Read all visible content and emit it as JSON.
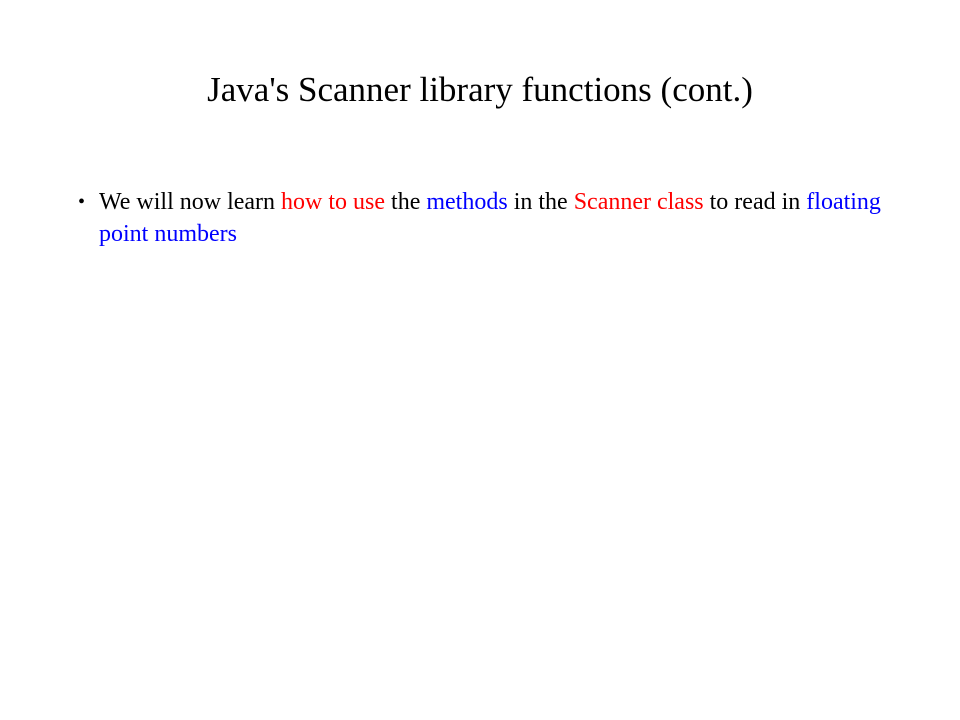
{
  "title": "Java's Scanner library functions (cont.)",
  "bullet": {
    "t1": "We will now learn ",
    "t2": "how to use",
    "t3": " the ",
    "t4": "methods",
    "t5": " in the ",
    "t6": "Scanner class",
    "t7": " to read in ",
    "t8": "floating point numbers"
  }
}
